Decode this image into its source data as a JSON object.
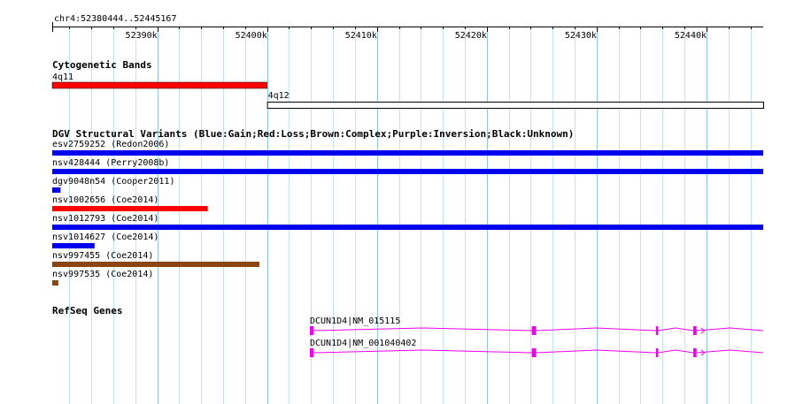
{
  "ruler": {
    "coordinate_label": "chr4:52380444..52445167",
    "ticks": [
      {
        "pos": 52390000,
        "label": "52390k"
      },
      {
        "pos": 52400000,
        "label": "52400k"
      },
      {
        "pos": 52410000,
        "label": "52410k"
      },
      {
        "pos": 52420000,
        "label": "52420k"
      },
      {
        "pos": 52430000,
        "label": "52430k"
      },
      {
        "pos": 52440000,
        "label": "52440k"
      }
    ]
  },
  "tracks": {
    "cytoband": {
      "title": "Cytogenetic Bands",
      "bands": [
        {
          "name": "4q11",
          "start": 52380444,
          "end": 52400000,
          "color": "#ff0000"
        },
        {
          "name": "4q12",
          "start": 52400000,
          "end": 52445167,
          "color": "#ffffff"
        }
      ]
    },
    "dgv": {
      "title": "DGV Structural Variants (Blue:Gain;Red:Loss;Brown:Complex;Purple:Inversion;Black:Unknown)",
      "variants": [
        {
          "label": "esv2759252 (Redon2006)",
          "start": 52380444,
          "end": 52445167,
          "color": "#0000ee"
        },
        {
          "label": "nsv428444 (Perry2008b)",
          "start": 52380444,
          "end": 52445167,
          "color": "#0000ee"
        },
        {
          "label": "dgv9048n54 (Cooper2011)",
          "start": 52380444,
          "end": 52381200,
          "color": "#0000ee"
        },
        {
          "label": "nsv1002656 (Coe2014)",
          "start": 52380444,
          "end": 52394600,
          "color": "#ff0000"
        },
        {
          "label": "nsv1012793 (Coe2014)",
          "start": 52380444,
          "end": 52445167,
          "color": "#0000ee"
        },
        {
          "label": "nsv1014627 (Coe2014)",
          "start": 52380444,
          "end": 52384300,
          "color": "#0000ee"
        },
        {
          "label": "nsv997455 (Coe2014)",
          "start": 52380444,
          "end": 52399300,
          "color": "#8b4513"
        },
        {
          "label": "nsv997535 (Coe2014)",
          "start": 52380444,
          "end": 52381000,
          "color": "#8b4513"
        }
      ]
    },
    "refseq": {
      "title": "RefSeq Genes",
      "color": "#ee00ee",
      "genes": [
        {
          "label": "DCUN1D4|NM_015115",
          "start": 52403900,
          "end": 52445167,
          "exons": [
            [
              52403900,
              52404250
            ],
            [
              52424100,
              52424500
            ],
            [
              52435400,
              52435600
            ],
            [
              52438800,
              52439100
            ]
          ]
        },
        {
          "label": "DCUN1D4|NM_001040402",
          "start": 52403900,
          "end": 52445167,
          "exons": [
            [
              52403900,
              52404250
            ],
            [
              52424100,
              52424500
            ],
            [
              52435400,
              52435600
            ],
            [
              52438800,
              52439100
            ]
          ]
        }
      ]
    }
  }
}
